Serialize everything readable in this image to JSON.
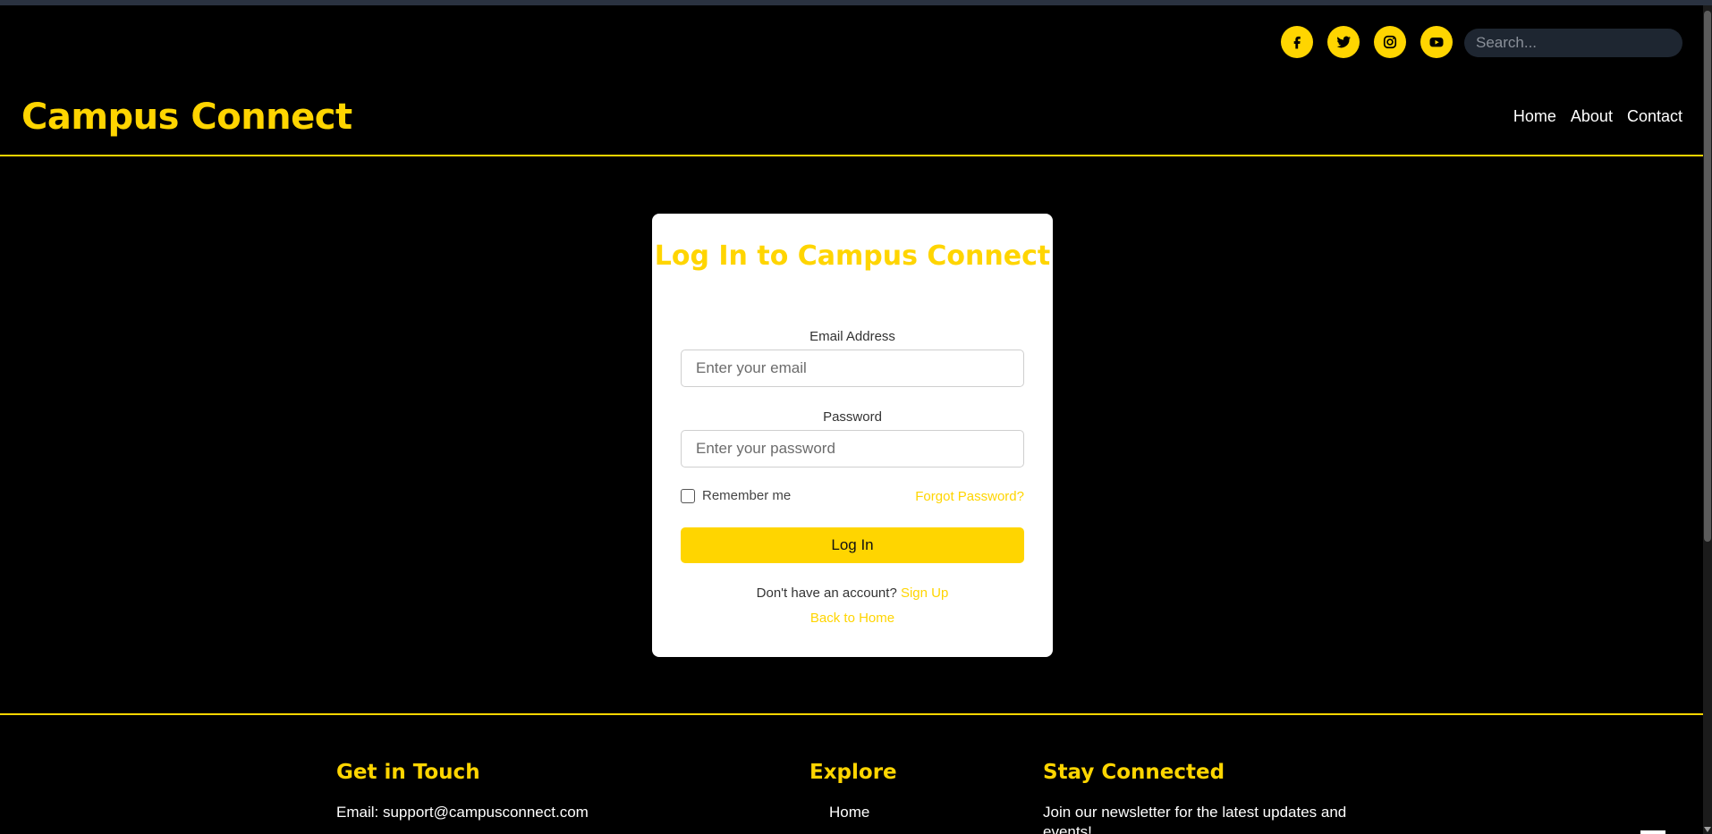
{
  "header": {
    "brand": "Campus Connect",
    "search_placeholder": "Search...",
    "social": [
      "facebook-icon",
      "twitter-icon",
      "instagram-icon",
      "youtube-icon"
    ],
    "nav": [
      "Home",
      "About",
      "Contact"
    ]
  },
  "login": {
    "title": "Log In to Campus Connect",
    "email_label": "Email Address",
    "email_placeholder": "Enter your email",
    "password_label": "Password",
    "password_placeholder": "Enter your password",
    "remember_label": "Remember me",
    "remember_checked": false,
    "forgot_link": "Forgot Password?",
    "submit_label": "Log In",
    "no_account_text": "Don't have an account?",
    "signup_link": "Sign Up",
    "back_link": "Back to Home"
  },
  "footer": {
    "contact_heading": "Get in Touch",
    "contact_email": "Email: support@campusconnect.com",
    "explore_heading": "Explore",
    "explore_items": [
      "Home"
    ],
    "newsletter_heading": "Stay Connected",
    "newsletter_text": "Join our newsletter for the latest updates and events!"
  },
  "colors": {
    "accent": "#ffd500",
    "background": "#000000",
    "card": "#ffffff"
  }
}
